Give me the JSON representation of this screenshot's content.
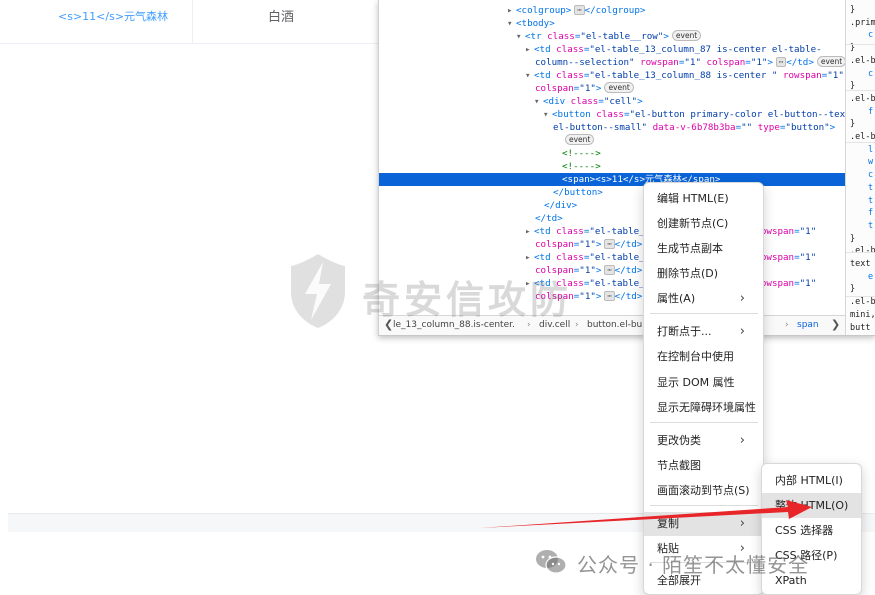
{
  "page": {
    "row_link_text": "<s>11</s>元气森林",
    "row_cell_text": "白酒"
  },
  "inspector": {
    "lines": [
      {
        "indent": 0,
        "tri": "▸",
        "html": [
          "tw:<colgroup>",
          "ell:⋯",
          "tw:</colgroup>"
        ]
      },
      {
        "indent": 0,
        "tri": "▾",
        "html": [
          "tw:<tbody>"
        ]
      },
      {
        "indent": 1,
        "tri": "▾",
        "html": [
          "tw:<tr ",
          "at:class",
          "tw:=",
          "av:\"el-table__row\"",
          "tw:>",
          "badge:event"
        ]
      },
      {
        "indent": 2,
        "tri": "▸",
        "html": [
          "tw:<td ",
          "at:class",
          "tw:=",
          "av:\"el-table_13_column_87 is-center el-table-"
        ]
      },
      {
        "indent": 2,
        "tri": "",
        "html": [
          "av:column--selection\"",
          "at: rowspan",
          "tw:=",
          "av:\"1\"",
          "at: colspan",
          "tw:=",
          "av:\"1\"",
          "tw:>",
          "ell:⋯",
          "tw:</td>",
          "badge:event"
        ]
      },
      {
        "indent": 2,
        "tri": "▾",
        "html": [
          "tw:<td ",
          "at:class",
          "tw:=",
          "av:\"el-table_13_column_88 is-center \"",
          "at: rowspan",
          "tw:=",
          "av:\"1\""
        ]
      },
      {
        "indent": 2,
        "tri": "",
        "html": [
          "at:colspan",
          "tw:=",
          "av:\"1\"",
          "tw:>",
          "badge:event"
        ]
      },
      {
        "indent": 3,
        "tri": "▾",
        "html": [
          "tw:<div ",
          "at:class",
          "tw:=",
          "av:\"cell\"",
          "tw:>"
        ]
      },
      {
        "indent": 4,
        "tri": "▾",
        "html": [
          "tw:<button ",
          "at:class",
          "tw:=",
          "av:\"el-button primary-color el-button--text"
        ]
      },
      {
        "indent": 4,
        "tri": "",
        "html": [
          "av:el-button--small\"",
          "at: data-v-6b78b3ba",
          "tw:=",
          "av:\"\"",
          "at: type",
          "tw:=",
          "av:\"button\"",
          "tw:>"
        ]
      },
      {
        "indent": 5,
        "tri": "",
        "html": [
          "badge:event"
        ]
      },
      {
        "indent": 5,
        "tri": "",
        "html": [
          "cm:<!---->"
        ]
      },
      {
        "indent": 5,
        "tri": "",
        "html": [
          "cm:<!---->"
        ]
      },
      {
        "indent": 5,
        "tri": "",
        "selected": true,
        "html": [
          "tw:<span><s>11</s>元气森林</span>"
        ]
      },
      {
        "indent": 4,
        "tri": "",
        "html": [
          "tw:</button>"
        ]
      },
      {
        "indent": 3,
        "tri": "",
        "html": [
          "tw:</div>"
        ]
      },
      {
        "indent": 2,
        "tri": "",
        "html": [
          "tw:</td>"
        ]
      },
      {
        "indent": 2,
        "tri": "▸",
        "html": [
          "tw:<td ",
          "at:class",
          "tw:=",
          "av:\"el-table_",
          "tx:                  ",
          "av:\"",
          "at: rowspan",
          "tw:=",
          "av:\"1\""
        ]
      },
      {
        "indent": 2,
        "tri": "",
        "html": [
          "at:colspan",
          "tw:=",
          "av:\"1\"",
          "tw:>",
          "ell:⋯",
          "tw:</td>"
        ]
      },
      {
        "indent": 2,
        "tri": "▸",
        "html": [
          "tw:<td ",
          "at:class",
          "tw:=",
          "av:\"el-table_",
          "tx:                  ",
          "av:\"",
          "at: rowspan",
          "tw:=",
          "av:\"1\""
        ]
      },
      {
        "indent": 2,
        "tri": "",
        "html": [
          "at:colspan",
          "tw:=",
          "av:\"1\"",
          "tw:>",
          "ell:⋯",
          "tw:</td>"
        ]
      },
      {
        "indent": 2,
        "tri": "▸",
        "html": [
          "tw:<td ",
          "at:class",
          "tw:=",
          "av:\"el-table_",
          "tx:                  ",
          "av:\"",
          "at: rowspan",
          "tw:=",
          "av:\"1\""
        ]
      },
      {
        "indent": 2,
        "tri": "",
        "html": [
          "at:colspan",
          "tw:=",
          "av:\"1\"",
          "tw:>",
          "ell:⋯",
          "tw:</td>"
        ]
      }
    ],
    "breadcrumb": [
      {
        "label": "le_13_column_88.is-center."
      },
      {
        "label": "div.cell"
      },
      {
        "label": "button.el-bu"
      },
      {
        "label": "n..."
      },
      {
        "label": "span"
      }
    ]
  },
  "rules": {
    "lines": [
      "}",
      ".prim",
      "c",
      "}",
      ".el-b",
      "c",
      "}",
      ".el-b",
      "f",
      "}",
      ".el-b",
      "l",
      "w",
      "c",
      "t",
      "t",
      "f",
      "t",
      "}",
      ".el-b",
      "text",
      "e",
      "}",
      ".el-b",
      "mini,",
      "butt"
    ]
  },
  "watermark": {
    "text": "奇安信攻防"
  },
  "context_menu": {
    "items": [
      {
        "label": "编辑 HTML(E)"
      },
      {
        "label": "创建新节点(C)"
      },
      {
        "label": "生成节点副本"
      },
      {
        "label": "删除节点(D)"
      },
      {
        "label": "属性(A)",
        "submenu": true
      },
      {
        "label": "打断点于...",
        "submenu": true
      },
      {
        "label": "在控制台中使用"
      },
      {
        "label": "显示 DOM 属性"
      },
      {
        "label": "显示无障碍环境属性"
      },
      {
        "label": "更改伪类",
        "submenu": true
      },
      {
        "label": "节点截图"
      },
      {
        "label": "画面滚动到节点(S)"
      },
      {
        "label": "复制",
        "submenu": true,
        "highlighted": true
      },
      {
        "label": "粘贴",
        "submenu": true
      },
      {
        "label": "全部展开"
      }
    ]
  },
  "copy_submenu": {
    "items": [
      {
        "label": "内部 HTML(I)"
      },
      {
        "label": "整体 HTML(O)",
        "highlighted": true
      },
      {
        "label": "CSS 选择器"
      },
      {
        "label": "CSS 路径(P)"
      },
      {
        "label": "XPath"
      }
    ]
  },
  "footer": {
    "wechat_text": "公众号 · 陌笙不太懂安全"
  },
  "colors": {
    "selection": "#0a64d8",
    "tag": "#0074e8",
    "attr_name": "#dd00a9",
    "attr_value": "#003eaa",
    "arrow": "#e8262a",
    "link": "#409eff"
  },
  "icons": {
    "submenu_arrow": "chevron-right-icon",
    "breadcrumb_left": "chevron-left-icon",
    "breadcrumb_right": "chevron-right-icon",
    "expand_open": "triangle-down-icon",
    "expand_closed": "triangle-right-icon",
    "watermark_logo": "lightning-shield-icon",
    "wechat_logo": "wechat-icon"
  }
}
